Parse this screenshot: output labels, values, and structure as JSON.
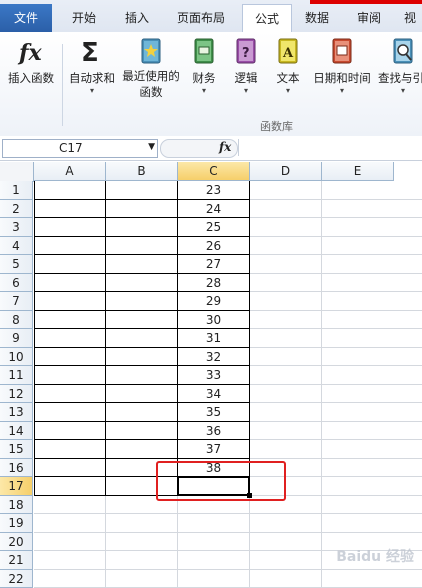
{
  "tabs": [
    {
      "label": "文件"
    },
    {
      "label": "开始"
    },
    {
      "label": "插入"
    },
    {
      "label": "页面布局"
    },
    {
      "label": "公式"
    },
    {
      "label": "数据"
    },
    {
      "label": "审阅"
    },
    {
      "label": "视"
    }
  ],
  "ribbon": {
    "insert_function": "插入函数",
    "autosum": "自动求和",
    "recent_line1": "最近使用的",
    "recent_line2": "函数",
    "financial": "财务",
    "logical": "逻辑",
    "text": "文本",
    "datetime": "日期和时间",
    "lookup": "查找与引",
    "group_label": "函数库"
  },
  "formula_bar": {
    "name_box": "C17",
    "fx_label": "fx",
    "formula": ""
  },
  "columns": [
    "A",
    "B",
    "C",
    "D",
    "E"
  ],
  "rows": [
    "1",
    "2",
    "3",
    "4",
    "5",
    "6",
    "7",
    "8",
    "9",
    "10",
    "11",
    "12",
    "13",
    "14",
    "15",
    "16",
    "17",
    "18",
    "19",
    "20",
    "21",
    "22"
  ],
  "column_c_values": [
    "23",
    "24",
    "25",
    "26",
    "27",
    "28",
    "29",
    "30",
    "31",
    "32",
    "33",
    "34",
    "35",
    "36",
    "37",
    "38"
  ],
  "active_cell": "C17",
  "watermark": "Baidu 经验",
  "colors": {
    "accent": "#2b5fa8",
    "selection": "#f6cf6a",
    "highlight_box": "#e02020"
  }
}
